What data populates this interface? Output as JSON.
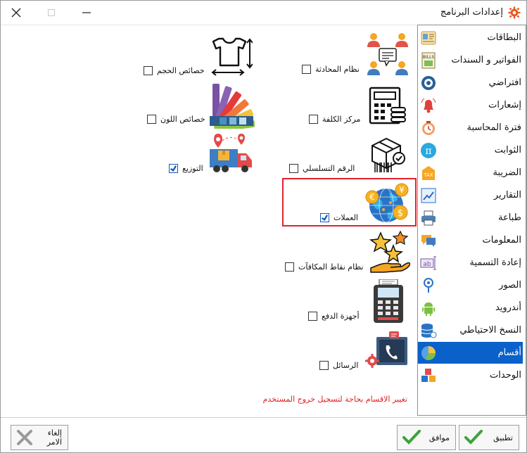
{
  "window": {
    "title": "إعدادات البرنامج",
    "title_icon": "gear-icon"
  },
  "sidebar": {
    "items": [
      {
        "label": "البطاقات",
        "icon": "cards-icon"
      },
      {
        "label": "الفواتير و السندات",
        "icon": "bills-icon"
      },
      {
        "label": "افتراضي",
        "icon": "default-gear-icon"
      },
      {
        "label": "إشعارات",
        "icon": "bell-icon"
      },
      {
        "label": "فترة المحاسبة",
        "icon": "accounting-period-icon"
      },
      {
        "label": "الثوابت",
        "icon": "pi-icon"
      },
      {
        "label": "الضريبة",
        "icon": "tax-icon"
      },
      {
        "label": "التقارير",
        "icon": "reports-icon"
      },
      {
        "label": "طباعة",
        "icon": "printer-icon"
      },
      {
        "label": "المعلومات",
        "icon": "chat-info-icon"
      },
      {
        "label": "إعادة التسمية",
        "icon": "rename-icon"
      },
      {
        "label": "الصور",
        "icon": "image-pin-icon"
      },
      {
        "label": "أندرويد",
        "icon": "android-icon"
      },
      {
        "label": "النسخ الاحتياطي",
        "icon": "backup-database-icon"
      },
      {
        "label": "أقسام",
        "icon": "pie-chart-icon"
      },
      {
        "label": "الوحدات",
        "icon": "cubes-icon"
      }
    ],
    "selected_index": 14
  },
  "features": {
    "chat": {
      "label": "نظام المحادثة",
      "checked": false
    },
    "size": {
      "label": "خصائص الحجم",
      "checked": false
    },
    "cost_center": {
      "label": "مركز الكلفة",
      "checked": false
    },
    "color": {
      "label": "خصائص اللون",
      "checked": false
    },
    "serial": {
      "label": "الرقم التسلسلي",
      "checked": false
    },
    "distribution": {
      "label": "التوزيع",
      "checked": true
    },
    "currencies": {
      "label": "العملات",
      "checked": true
    },
    "rewards": {
      "label": "نظام نقاط المكافآت",
      "checked": false
    },
    "payment_devices": {
      "label": "أجهزة الدفع",
      "checked": false
    },
    "messages": {
      "label": "الرسائل",
      "checked": false
    }
  },
  "note": "تغيير الاقسام بحاجة لتسجيل خروج المستخدم",
  "buttons": {
    "apply": "تطبيق",
    "ok": "موافق",
    "cancel": "إلغاء الامر"
  },
  "colors": {
    "selected": "#0a61c9",
    "highlight": "#e1222d",
    "note": "#e02020"
  }
}
